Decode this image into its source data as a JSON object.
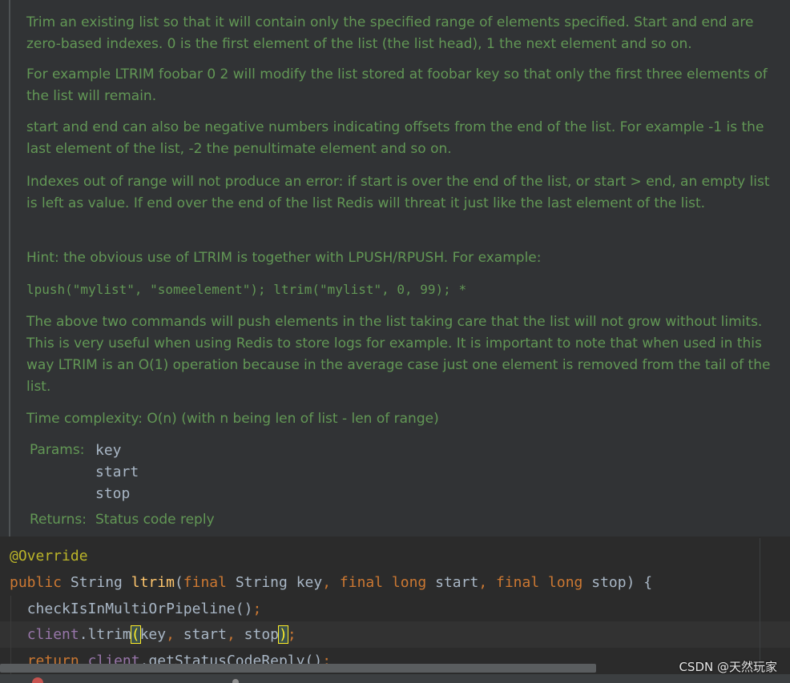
{
  "doc": {
    "p1": "Trim an existing list so that it will contain only the specified range of elements specified. Start and end are zero-based indexes. 0 is the first element of the list (the list head), 1 the next element and so on.",
    "p2": "For example LTRIM foobar 0 2 will modify the list stored at foobar key so that only the first three elements of the list will remain.",
    "p3": "start and end can also be negative numbers indicating offsets from the end of the list. For example -1 is the last element of the list, -2 the penultimate element and so on.",
    "p4": "Indexes out of range will not produce an error: if start is over the end of the list, or start > end, an empty list is left as value. If end over the end of the list Redis will threat it just like the last element of the list.",
    "p5": "Hint: the obvious use of LTRIM is together with LPUSH/RPUSH. For example:",
    "code_example": "lpush(\"mylist\", \"someelement\"); ltrim(\"mylist\", 0, 99); *",
    "p6": "The above two commands will push elements in the list taking care that the list will not grow without limits. This is very useful when using Redis to store logs for example. It is important to note that when used in this way LTRIM is an O(1) operation because in the average case just one element is removed from the tail of the list.",
    "p7": "Time complexity: O(n) (with n being len of list - len of range)",
    "params_label": "Params:",
    "params": [
      "key",
      "start",
      "stop"
    ],
    "returns_label": "Returns:",
    "returns_value": "Status code reply"
  },
  "code": {
    "annotation": "@Override",
    "kw_public": "public",
    "type_string": "String",
    "method_name": "ltrim",
    "kw_final": "final",
    "type_long": "long",
    "param_key": "key",
    "param_start": "start",
    "param_stop": "stop",
    "call_check": "checkIsInMultiOrPipeline",
    "field_client": "client",
    "call_ltrim": "ltrim",
    "kw_return": "return",
    "call_reply": "getStatusCodeReply"
  },
  "watermark": "CSDN @天然玩家",
  "colors": {
    "background": "#2b2b2b",
    "doc_background": "#313335",
    "doc_text": "#629755",
    "keyword": "#cc7832",
    "annotation": "#bbb529",
    "method": "#ffc66d",
    "field": "#9876aa",
    "default_text": "#a9b7c6"
  }
}
